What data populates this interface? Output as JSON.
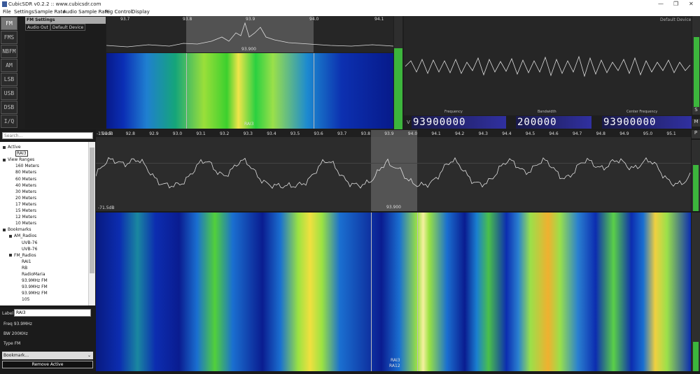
{
  "window": {
    "title": "CubicSDR v0.2.2 :: www.cubicsdr.com",
    "controls": [
      "—",
      "❐",
      "✕"
    ]
  },
  "menu": [
    "File",
    "Settings",
    "Sample Rate",
    "Audio Sample Rate",
    "Rig Control",
    "Display"
  ],
  "modes": [
    "FM",
    "FMS",
    "NBFM",
    "AM",
    "LSB",
    "USB",
    "DSB",
    "I/Q"
  ],
  "active_mode": "FM",
  "mod_settings": {
    "header": "FM Settings",
    "row_label": "Audio Out",
    "row_value": "Default Device"
  },
  "mini_spectrum": {
    "ticks": [
      "93.7",
      "93.8",
      "93.9",
      "94.0",
      "94.1"
    ],
    "center_label": "93.900"
  },
  "mini_waterfall": {
    "marker": "RAI3"
  },
  "scope": {
    "device_label": "Default Device",
    "labels": [
      "S",
      "M",
      "P"
    ]
  },
  "tuning": {
    "v_label": "V",
    "frequency_label": "Frequency",
    "frequency": "93900000",
    "bandwidth_label": "Bandwidth",
    "bandwidth": "200000",
    "center_label": "Center Frequency",
    "center": "93900000"
  },
  "search": {
    "placeholder": "Search..."
  },
  "tree": [
    {
      "label": "Active",
      "level": 0,
      "box": true
    },
    {
      "label": "RAI3",
      "level": 2,
      "selected": true
    },
    {
      "label": "View Ranges",
      "level": 0,
      "box": true
    },
    {
      "label": "160 Meters",
      "level": 2
    },
    {
      "label": "80 Meters",
      "level": 2
    },
    {
      "label": "60 Meters",
      "level": 2
    },
    {
      "label": "40 Meters",
      "level": 2
    },
    {
      "label": "30 Meters",
      "level": 2
    },
    {
      "label": "20 Meters",
      "level": 2
    },
    {
      "label": "17 Meters",
      "level": 2
    },
    {
      "label": "15 Meters",
      "level": 2
    },
    {
      "label": "12 Meters",
      "level": 2
    },
    {
      "label": "10 Meters",
      "level": 2
    },
    {
      "label": "Bookmarks",
      "level": 0,
      "box": true
    },
    {
      "label": "AM_Radios",
      "level": 1,
      "box": true
    },
    {
      "label": "UVB-76",
      "level": 3
    },
    {
      "label": "UVB-76",
      "level": 3
    },
    {
      "label": "FM_Radios",
      "level": 1,
      "box": true
    },
    {
      "label": "RAI1",
      "level": 3
    },
    {
      "label": "RB",
      "level": 3
    },
    {
      "label": "RadioMaria",
      "level": 3
    },
    {
      "label": "93.9MHz FM",
      "level": 3
    },
    {
      "label": "93.9MHz FM",
      "level": 3
    },
    {
      "label": "93.9MHz FM",
      "level": 3
    },
    {
      "label": "105",
      "level": 3
    }
  ],
  "props": {
    "label_caption": "Label",
    "label_value": "RAI3",
    "freq_text": "Freq 93.9MHz",
    "bw_text": "BW 200KHz",
    "type_text": "Type FM",
    "select_value": "Bookmark...",
    "remove_button": "Remove Active"
  },
  "main_spectrum": {
    "ticks": [
      "92.7",
      "92.8",
      "92.9",
      "93.0",
      "93.1",
      "93.2",
      "93.3",
      "93.4",
      "93.5",
      "93.6",
      "93.7",
      "93.8",
      "93.9",
      "94.0",
      "94.1",
      "94.2",
      "94.3",
      "94.4",
      "94.5",
      "94.6",
      "94.7",
      "94.8",
      "94.9",
      "95.0",
      "95.1"
    ],
    "db_top": "-15.0dB",
    "db_bottom": "-71.5dB",
    "center_label": "93.900"
  },
  "main_waterfall": {
    "marker_name": "RAI3",
    "marker_sub": "RA12"
  },
  "colors": {
    "active_mode": "#777777",
    "waterfall_bg": "#0a1a8c",
    "meter": "#3cb53c",
    "selection": "#9a9a9a"
  }
}
